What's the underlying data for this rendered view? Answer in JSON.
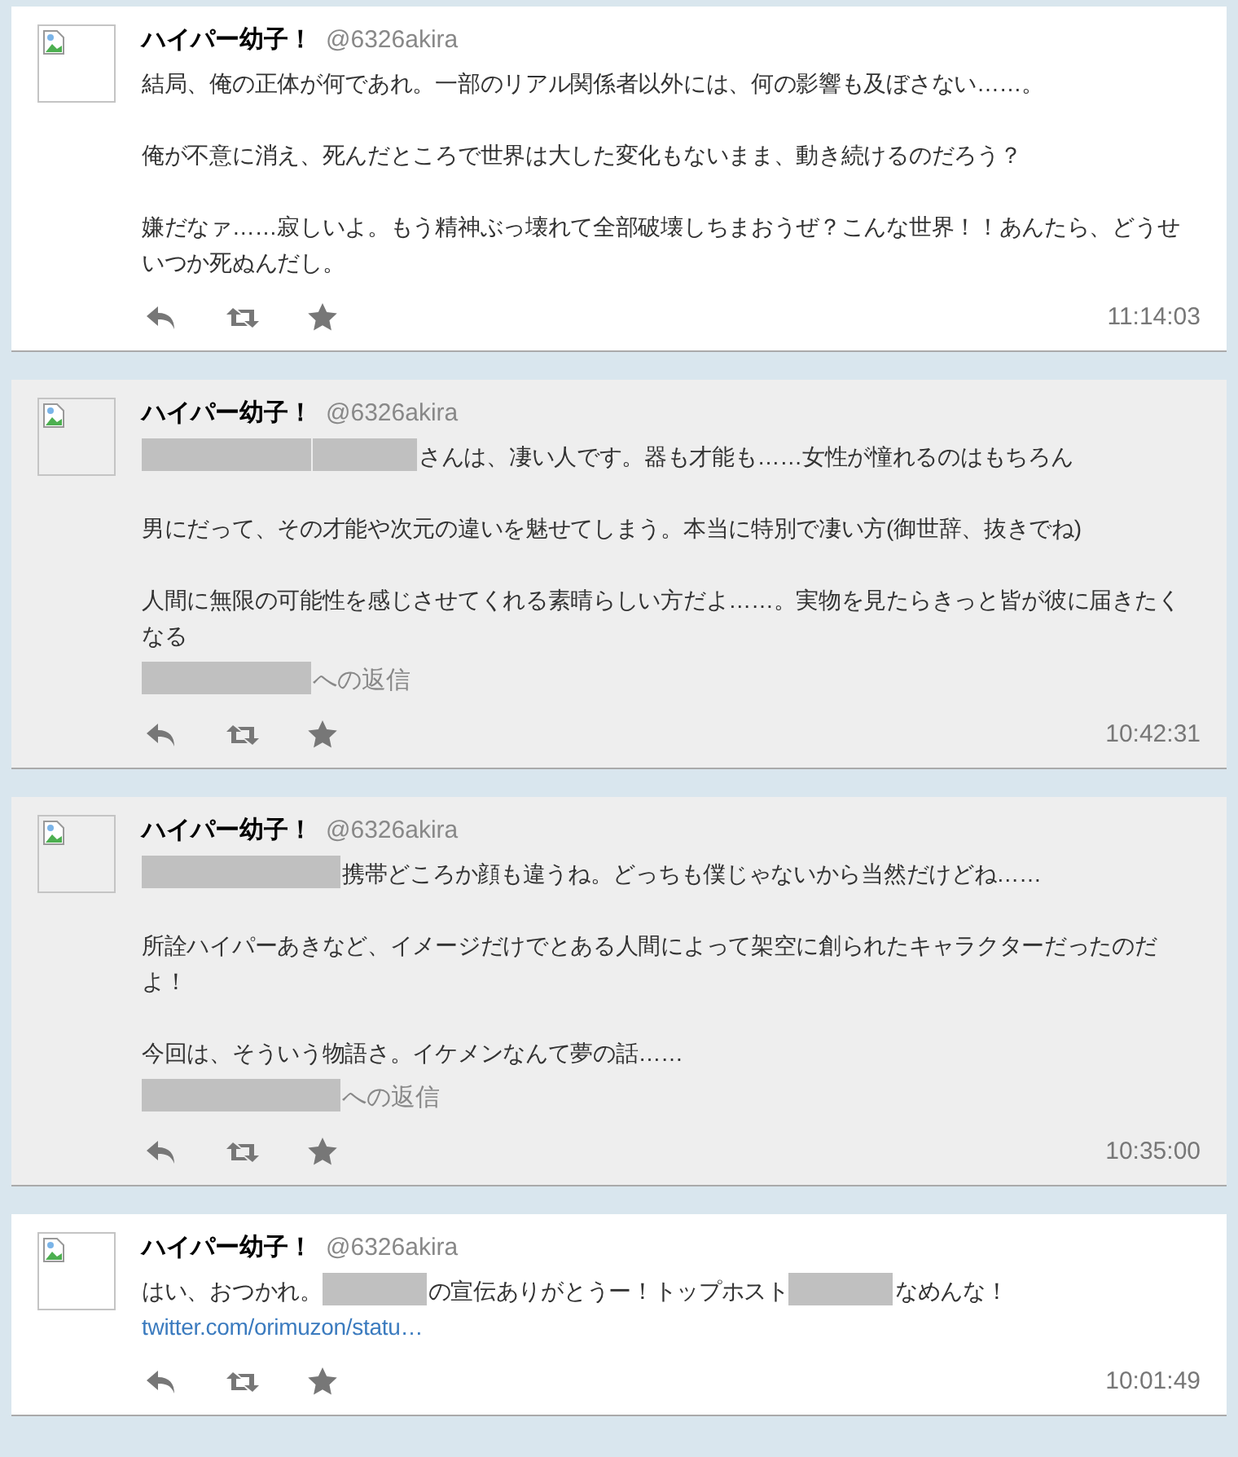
{
  "tweets": [
    {
      "highlighted": false,
      "name": "ハイパー幼子！",
      "handle": "@6326akira",
      "paragraphs": [
        [
          {
            "kind": "text",
            "text": "結局、俺の正体が何であれ。一部のリアル関係者以外には、何の影響も及ぼさない……。"
          }
        ],
        [
          {
            "kind": "text",
            "text": "俺が不意に消え、死んだところで世界は大した変化もないまま、動き続けるのだろう？"
          }
        ],
        [
          {
            "kind": "text",
            "text": "嫌だなァ……寂しいよ。もう精神ぶっ壊れて全部破壊しちまおうぜ？こんな世界！！あんたら、どうせいつか死ぬんだし。"
          }
        ]
      ],
      "time": "11:14:03"
    },
    {
      "highlighted": true,
      "name": "ハイパー幼子！",
      "handle": "@6326akira",
      "paragraphs": [
        [
          {
            "kind": "redactedlong"
          },
          {
            "kind": "redacted"
          },
          {
            "kind": "text",
            "text": "さんは、凄い人です。器も才能も……女性が憧れるのはもちろん"
          }
        ],
        [
          {
            "kind": "text",
            "text": "男にだって、その才能や次元の違いを魅せてしまう。本当に特別で凄い方(御世辞、抜きでね)"
          }
        ],
        [
          {
            "kind": "text",
            "text": "人間に無限の可能性を感じさせてくれる素晴らしい方だよ……。実物を見たらきっと皆が彼に届きたくなる"
          }
        ]
      ],
      "reply_to": [
        {
          "kind": "redactedlong"
        },
        {
          "kind": "text",
          "text": "への返信"
        }
      ],
      "time": "10:42:31"
    },
    {
      "highlighted": true,
      "name": "ハイパー幼子！",
      "handle": "@6326akira",
      "paragraphs": [
        [
          {
            "kind": "redactedxlong"
          },
          {
            "kind": "text",
            "text": "携帯どころか顔も違うね。どっちも僕じゃないから当然だけどね……"
          }
        ],
        [
          {
            "kind": "text",
            "text": "所詮ハイパーあきなど、イメージだけでとある人間によって架空に創られたキャラクターだったのだよ！"
          }
        ],
        [
          {
            "kind": "text",
            "text": "今回は、そういう物語さ。イケメンなんて夢の話……"
          }
        ]
      ],
      "reply_to": [
        {
          "kind": "redactedxlong"
        },
        {
          "kind": "text",
          "text": "への返信"
        }
      ],
      "time": "10:35:00"
    },
    {
      "highlighted": false,
      "name": "ハイパー幼子！",
      "handle": "@6326akira",
      "paragraphs": [
        [
          {
            "kind": "text",
            "text": "はい、おつかれ。"
          },
          {
            "kind": "redacted"
          },
          {
            "kind": "text",
            "text": "の宣伝ありがとうー！トップホスト"
          },
          {
            "kind": "redacted"
          },
          {
            "kind": "text",
            "text": "なめんな！"
          },
          {
            "kind": "break"
          },
          {
            "kind": "link",
            "text": "twitter.com/orimuzon/statu…"
          }
        ]
      ],
      "time": "10:01:49"
    }
  ]
}
